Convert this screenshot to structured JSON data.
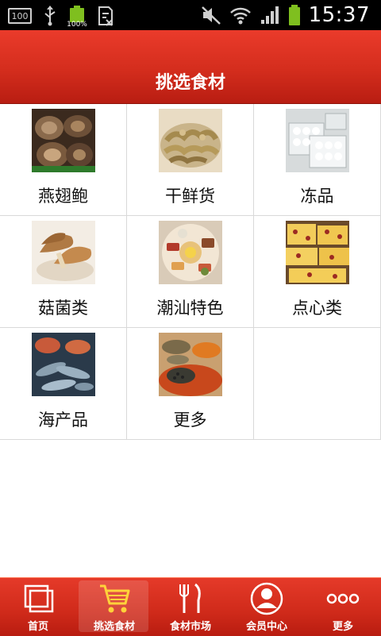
{
  "status_bar": {
    "left_indicators": [
      "100",
      "usb-icon",
      "battery-icon",
      "sd-icon"
    ],
    "battery_small_label": "100%",
    "time": "15:37",
    "right_indicators": [
      "mute-icon",
      "wifi-icon",
      "signal-icon",
      "battery-icon"
    ]
  },
  "header": {
    "title": "挑选食材"
  },
  "categories": [
    {
      "label": "燕翅鲍",
      "image": "abalone"
    },
    {
      "label": "干鲜货",
      "image": "dried-goods"
    },
    {
      "label": "冻品",
      "image": "frozen-dumplings"
    },
    {
      "label": "菇菌类",
      "image": "mushrooms"
    },
    {
      "label": "潮汕特色",
      "image": "chaoshan-platter"
    },
    {
      "label": "点心类",
      "image": "pastry"
    },
    {
      "label": "海产品",
      "image": "seafood"
    },
    {
      "label": "更多",
      "image": "spices"
    }
  ],
  "tabbar": {
    "tabs": [
      {
        "label": "首页",
        "icon": "home-icon",
        "active": false
      },
      {
        "label": "挑选食材",
        "icon": "cart-icon",
        "active": true
      },
      {
        "label": "食材市场",
        "icon": "fork-knife-icon",
        "active": false
      },
      {
        "label": "会员中心",
        "icon": "user-icon",
        "active": false
      },
      {
        "label": "更多",
        "icon": "more-icon",
        "active": false
      }
    ]
  },
  "colors": {
    "header": "#d42d1d",
    "tabbar": "#cf2a1a",
    "grid_line": "#d9d9d9"
  }
}
